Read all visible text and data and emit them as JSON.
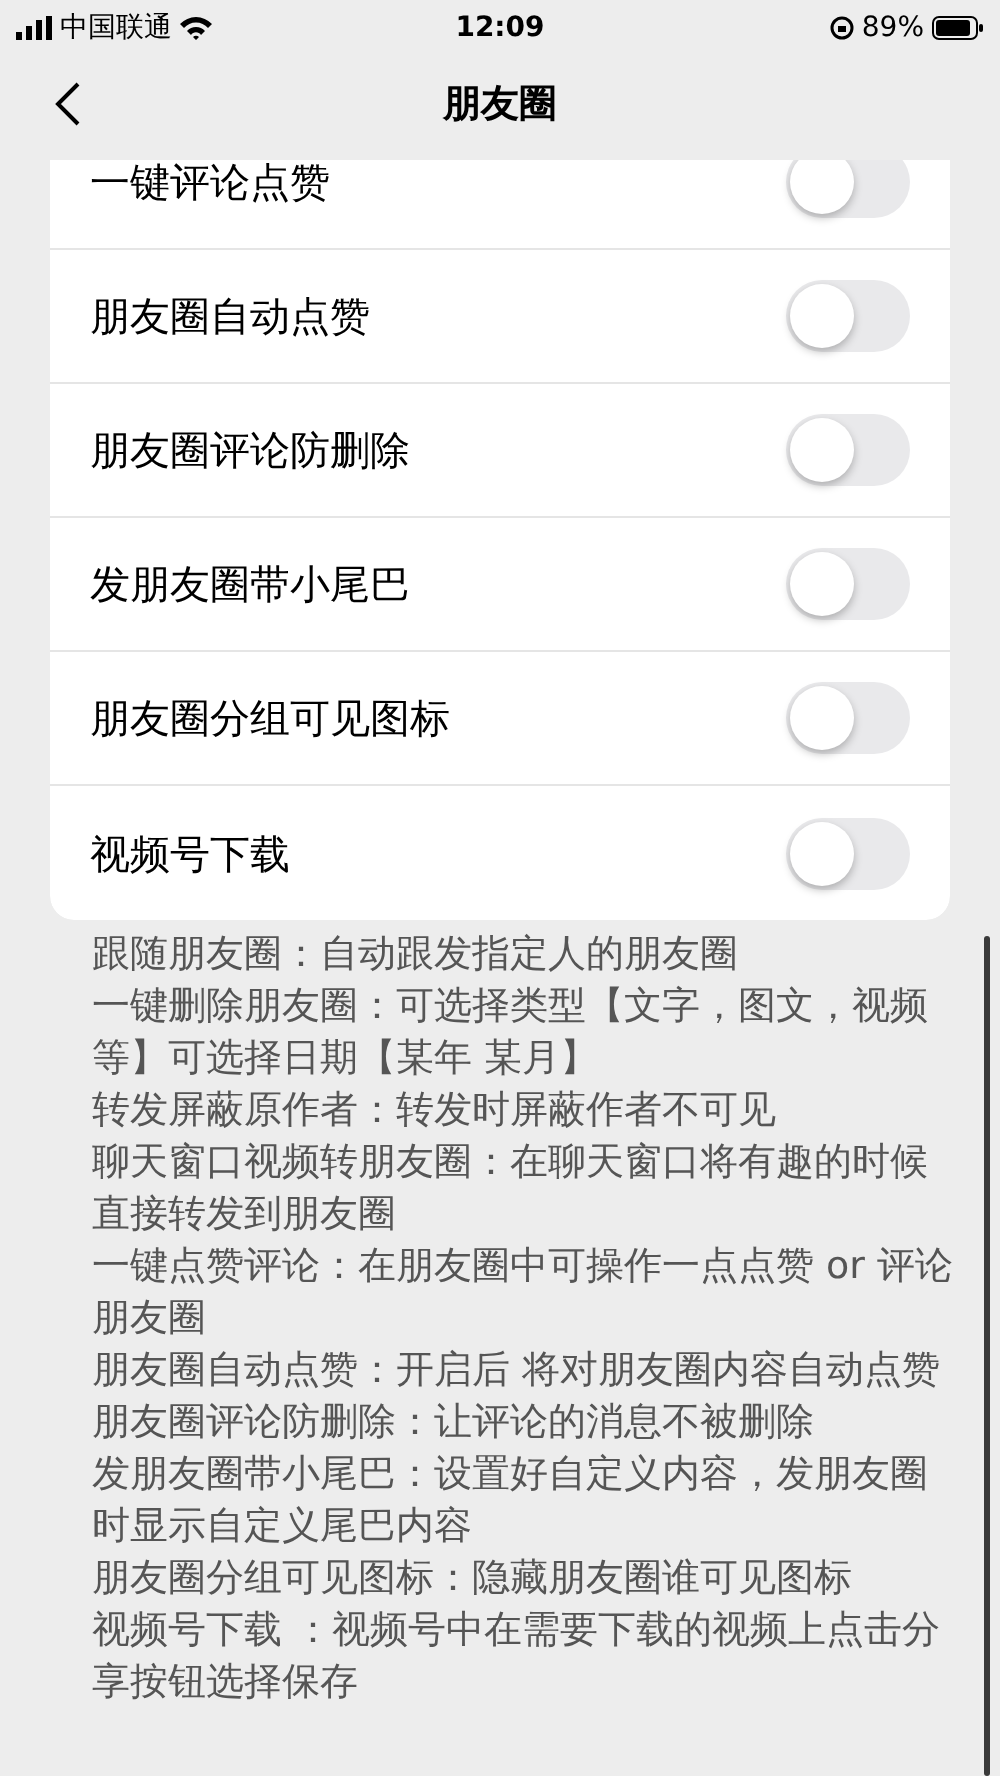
{
  "status_bar": {
    "carrier": "中国联通",
    "time": "12:09",
    "battery": "89%"
  },
  "nav": {
    "title": "朋友圈"
  },
  "settings": [
    {
      "label": "一键评论点赞",
      "on": false
    },
    {
      "label": "朋友圈自动点赞",
      "on": false
    },
    {
      "label": "朋友圈评论防删除",
      "on": false
    },
    {
      "label": "发朋友圈带小尾巴",
      "on": false
    },
    {
      "label": "朋友圈分组可见图标",
      "on": false
    },
    {
      "label": "视频号下载",
      "on": false
    }
  ],
  "description_lines": [
    "跟随朋友圈：自动跟发指定人的朋友圈",
    "一键删除朋友圈：可选择类型【文字，图文，视频",
    "等】可选择日期【某年 某月】",
    "转发屏蔽原作者：转发时屏蔽作者不可见",
    "聊天窗口视频转朋友圈：在聊天窗口将有趣的时候",
    "直接转发到朋友圈",
    "一键点赞评论：在朋友圈中可操作一点点赞 or 评论",
    "朋友圈",
    "朋友圈自动点赞：开启后 将对朋友圈内容自动点赞",
    "朋友圈评论防删除：让评论的消息不被删除",
    "发朋友圈带小尾巴：设置好自定义内容，发朋友圈",
    "时显示自定义尾巴内容",
    "朋友圈分组可见图标：隐藏朋友圈谁可见图标",
    "视频号下载 ：视频号中在需要下载的视频上点击分",
    "享按钮选择保存"
  ]
}
